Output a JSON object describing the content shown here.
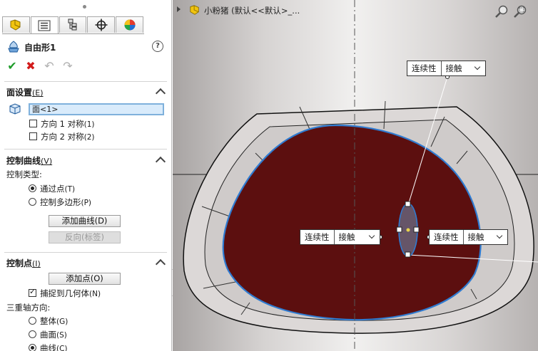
{
  "panel": {
    "title": "自由形1",
    "sections": {
      "face": {
        "title": "面设置",
        "accel": "(E)",
        "face_value": "面<1>",
        "dir1": "方向 1 对称",
        "dir1_accel": "(1)",
        "dir2": "方向 2 对称",
        "dir2_accel": "(2)"
      },
      "curves": {
        "title": "控制曲线",
        "accel": "(V)",
        "type_label": "控制类型:",
        "through": "通过点",
        "through_accel": "(T)",
        "polygon": "控制多边形",
        "polygon_accel": "(P)",
        "add_curve": "添加曲线",
        "add_curve_accel": "(D)",
        "reverse": "反向(标签)"
      },
      "points": {
        "title": "控制点",
        "accel": "(I)",
        "add_point": "添加点",
        "add_point_accel": "(O)",
        "snap": "捕捉到几何体",
        "snap_accel": "(N)",
        "triad_label": "三重轴方向:",
        "global": "整体",
        "global_accel": "(G)",
        "surface": "曲面",
        "surface_accel": "(S)",
        "curve": "曲线",
        "curve_accel": "(C)"
      }
    }
  },
  "viewport": {
    "tree_text": "小粉猪  (默认<<默认>_..."
  },
  "popups": [
    {
      "label": "连续性",
      "value": "接触"
    },
    {
      "label": "连续性",
      "value": "接触"
    },
    {
      "label": "连续性",
      "value": "接触"
    }
  ],
  "colors": {
    "face_fill": "#5c0f0f",
    "edge_blue": "#2f7bd1",
    "accept_green": "#1e9c2a",
    "cancel_red": "#d21a1a"
  }
}
